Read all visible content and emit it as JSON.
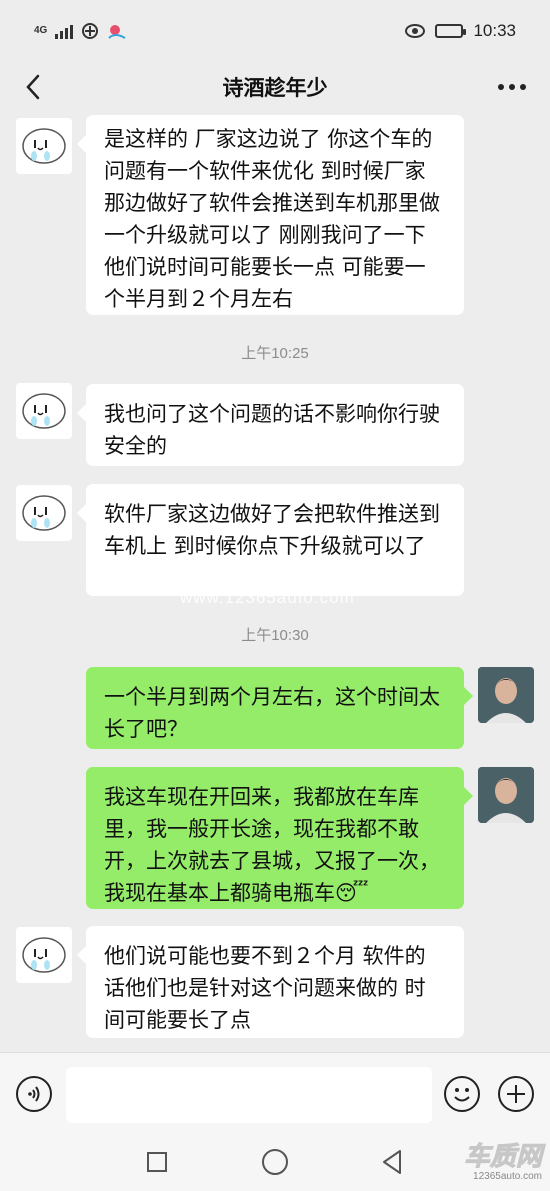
{
  "status_bar": {
    "network": "4G",
    "time": "10:33"
  },
  "header": {
    "title": "诗酒趁年少"
  },
  "messages": [
    {
      "side": "left",
      "text": "是这样的  厂家这边说了 你这个车的问题有一个软件来优化  到时候厂家那边做好了软件会推送到车机那里做一个升级就可以了   刚刚我问了一下他们说时间可能要长一点  可能要一个半月到２个月左右"
    },
    {
      "type": "time",
      "text": "上午10:25"
    },
    {
      "side": "left",
      "text": "我也问了这个问题的话不影响你行驶安全的"
    },
    {
      "side": "left",
      "text": "软件厂家这边做好了会把软件推送到车机上  到时候你点下升级就可以了"
    },
    {
      "type": "time",
      "text": "上午10:30"
    },
    {
      "side": "right",
      "text": "一个半月到两个月左右，这个时间太长了吧？"
    },
    {
      "side": "right",
      "text": "我这车现在开回来，我都放在车库里，我一般开长途，现在我都不敢开，上次就去了县城，又报了一次，我现在基本上都骑电瓶车😴"
    },
    {
      "side": "left",
      "text": "他们说可能也要不到２个月    软件的话他们也是针对这个问题来做的   时间可能要长了点"
    }
  ],
  "watermark": "www.12365auto.com",
  "input_bar": {
    "value": "",
    "placeholder": ""
  },
  "brand": {
    "name": "车质网",
    "url": "12365auto.com"
  },
  "colors": {
    "background": "#ededed",
    "self_bubble": "#95ec69",
    "other_bubble": "#ffffff"
  }
}
